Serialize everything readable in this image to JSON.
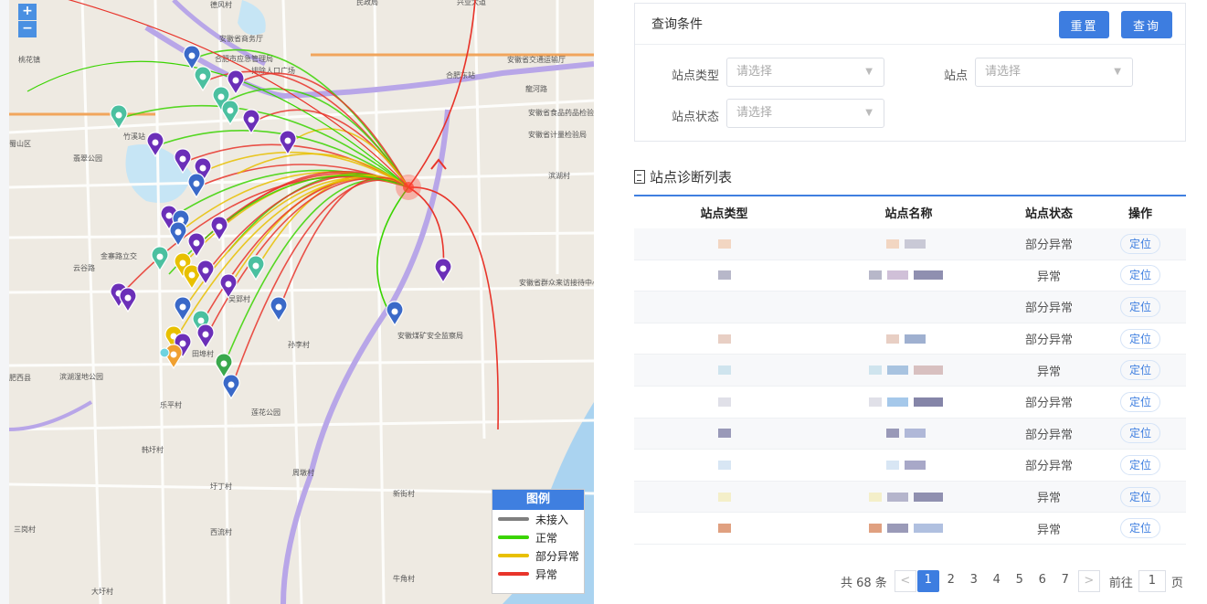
{
  "map": {
    "zoom_in": "+",
    "zoom_out": "−",
    "labels": [
      "桃花镇",
      "蜀山区",
      "竹溪站",
      "翡翠公园",
      "安徽省商务厅",
      "合肥市应急管理局",
      "排除人口广场",
      "安徽省交通运输厅",
      "合肥东站",
      "安徽省食品药品检验研究院",
      "安徽省计量检验局",
      "滨湖村",
      "云谷路",
      "金寨路立交",
      "安徽省群众来访接待中心",
      "安徽煤矿安全监察局",
      "孙李村",
      "田埠村",
      "吴郢村",
      "莲花公园",
      "滨湖湿地公园",
      "乐平村",
      "韩圩村",
      "圩丁村",
      "西流村",
      "新街村",
      "周墩村",
      "大圩村",
      "牛角村",
      "三岗村",
      "德风村",
      "龍河路",
      "肥西县",
      "兴业大道",
      "民政局"
    ],
    "colors": {
      "disconnected": "#7f7f7f",
      "normal": "#3ad400",
      "partial": "#e8c000",
      "abnormal": "#e8342a"
    }
  },
  "legend": {
    "title": "图例",
    "items": [
      {
        "label": "未接入",
        "color": "#7f7f7f"
      },
      {
        "label": "正常",
        "color": "#3ad400"
      },
      {
        "label": "部分异常",
        "color": "#e8c000"
      },
      {
        "label": "异常",
        "color": "#e8342a"
      }
    ]
  },
  "query": {
    "title": "查询条件",
    "reset": "重置",
    "search": "查询",
    "station_type_label": "站点类型",
    "station_label": "站点",
    "station_status_label": "站点状态",
    "placeholder": "请选择"
  },
  "list": {
    "title": "站点诊断列表",
    "headers": [
      "站点类型",
      "站点名称",
      "站点状态",
      "操作"
    ],
    "rows": [
      {
        "status": "部分异常",
        "action": "定位"
      },
      {
        "status": "异常",
        "action": "定位"
      },
      {
        "status": "部分异常",
        "action": "定位"
      },
      {
        "status": "部分异常",
        "action": "定位"
      },
      {
        "status": "异常",
        "action": "定位"
      },
      {
        "status": "部分异常",
        "action": "定位"
      },
      {
        "status": "部分异常",
        "action": "定位"
      },
      {
        "status": "部分异常",
        "action": "定位"
      },
      {
        "status": "异常",
        "action": "定位"
      },
      {
        "status": "异常",
        "action": "定位"
      }
    ]
  },
  "pagination": {
    "total": "共 68 条",
    "prev": "<",
    "pages": [
      "1",
      "2",
      "3",
      "4",
      "5",
      "6",
      "7"
    ],
    "current": "1",
    "next": ">",
    "goto_prefix": "前往",
    "goto_value": "1",
    "goto_suffix": "页"
  }
}
